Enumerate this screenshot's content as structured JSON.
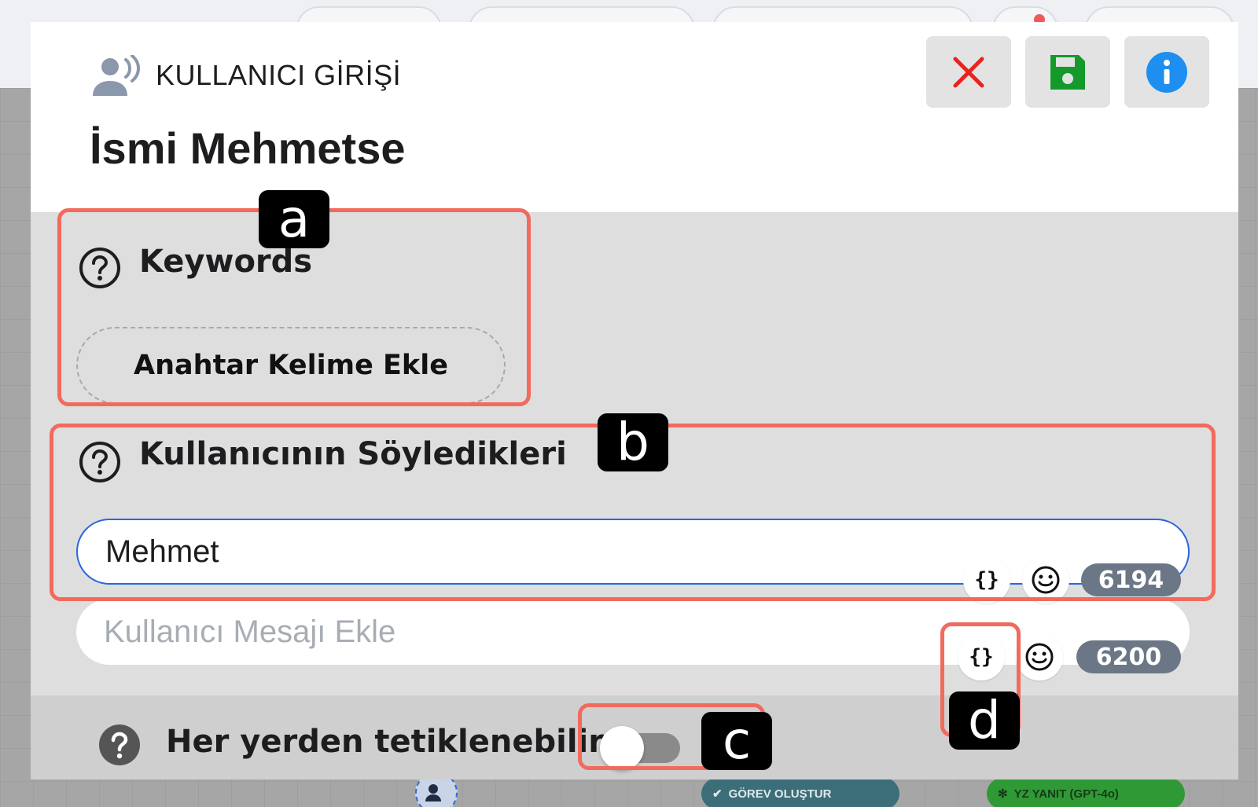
{
  "modal": {
    "kind_label": "KULLANICI GİRİŞİ",
    "title": "İsmi Mehmetse",
    "buttons": {
      "close_icon": "close-icon",
      "save_icon": "floppy-disk-icon",
      "info_icon": "info-icon"
    },
    "colors": {
      "close": "#e8231e",
      "save": "#149a2b",
      "info": "#1e8ef0",
      "input_focus": "#2a66e0",
      "annotation": "#f26a5e",
      "counter_bg": "#6b7686"
    }
  },
  "keywords": {
    "label": "Keywords",
    "add_button": "Anahtar Kelime Ekle"
  },
  "user_said": {
    "label": "Kullanıcının Söyledikleri",
    "messages": [
      {
        "value": "Mehmet",
        "counter": "6194"
      },
      {
        "value": "",
        "placeholder": "Kullanıcı Mesajı Ekle",
        "counter": "6200"
      }
    ],
    "variable_icon_text": "{}"
  },
  "trigger": {
    "label": "Her yerden tetiklenebilir",
    "enabled": false
  },
  "annotations": [
    "a",
    "b",
    "c",
    "d"
  ],
  "background": {
    "task_node": "GÖREV OLUŞTUR",
    "ai_node": "YZ YANIT (GPT-4o)"
  }
}
